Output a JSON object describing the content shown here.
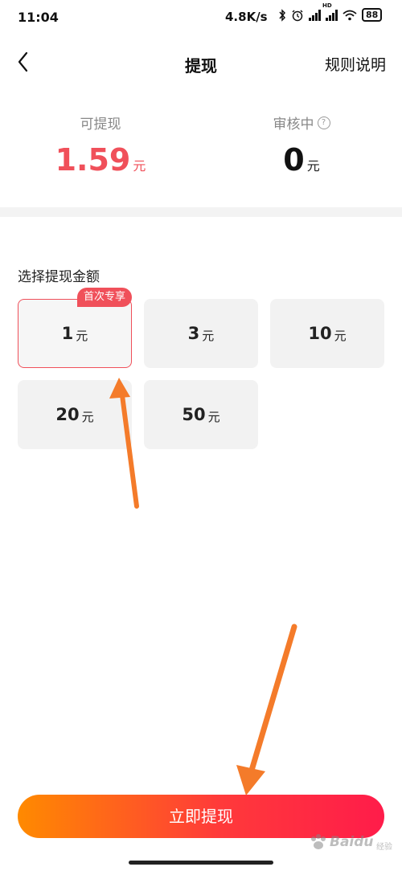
{
  "status_bar": {
    "time": "11:04",
    "net_speed": "4.8K/s",
    "battery": "88",
    "hd_label": "HD",
    "icon_names": [
      "bluetooth-icon",
      "alarm-icon",
      "signal-icon",
      "signal-hd-icon",
      "wifi-icon",
      "battery-icon"
    ]
  },
  "header": {
    "title": "提现",
    "rules_label": "规则说明"
  },
  "balance": {
    "withdrawable_label": "可提现",
    "withdrawable_amount": "1.59",
    "withdrawable_unit": "元",
    "reviewing_label": "审核中",
    "reviewing_amount": "0",
    "reviewing_unit": "元",
    "help_glyph": "?"
  },
  "amounts": {
    "section_label": "选择提现金额",
    "first_time_badge": "首次专享",
    "unit": "元",
    "options": [
      {
        "value": "1",
        "selected": true
      },
      {
        "value": "3",
        "selected": false
      },
      {
        "value": "10",
        "selected": false
      },
      {
        "value": "20",
        "selected": false
      },
      {
        "value": "50",
        "selected": false
      }
    ]
  },
  "action": {
    "withdraw_label": "立即提现"
  },
  "watermark": {
    "text": "Baidu",
    "sub": "经验"
  },
  "colors": {
    "accent_red": "#f0505a",
    "button_gradient_start": "#ff8a00",
    "button_gradient_end": "#ff1c4a",
    "annotation_arrow": "#f47b2a",
    "card_bg": "#f2f2f2"
  }
}
